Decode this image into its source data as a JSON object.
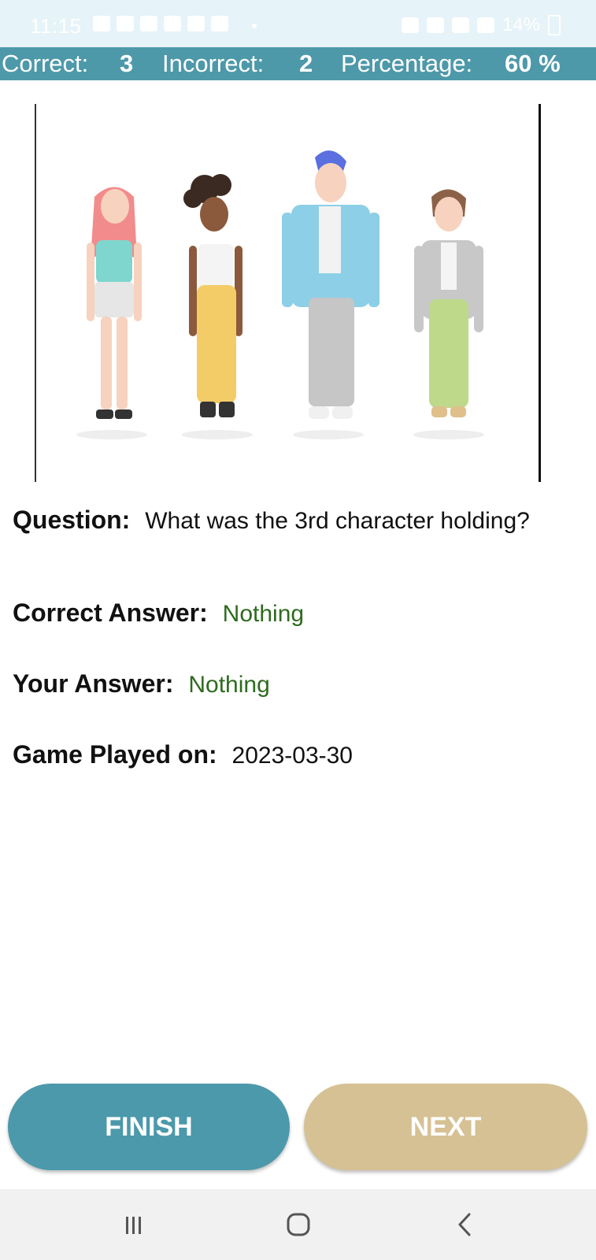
{
  "status_bar": {
    "time": "11:15",
    "battery": "14%"
  },
  "score": {
    "correct_label": "Correct:",
    "correct_value": "3",
    "incorrect_label": "Incorrect:",
    "incorrect_value": "2",
    "percentage_label": "Percentage:",
    "percentage_value": "60 %"
  },
  "question": {
    "label": "Question:",
    "text": "What was the 3rd character holding?"
  },
  "correct_answer": {
    "label": "Correct Answer:",
    "value": "Nothing"
  },
  "your_answer": {
    "label": "Your Answer:",
    "value": "Nothing"
  },
  "game_played": {
    "label": "Game Played on:",
    "value": "2023-03-30"
  },
  "buttons": {
    "finish": "FINISH",
    "next": "NEXT"
  },
  "colors": {
    "score_bar": "#4d99aa",
    "finish_button": "#4b99ab",
    "next_button": "#d5c193",
    "answer_green": "#2e6b1f"
  },
  "icons": {
    "recents": "recents-icon",
    "home": "home-icon",
    "back": "back-icon"
  }
}
